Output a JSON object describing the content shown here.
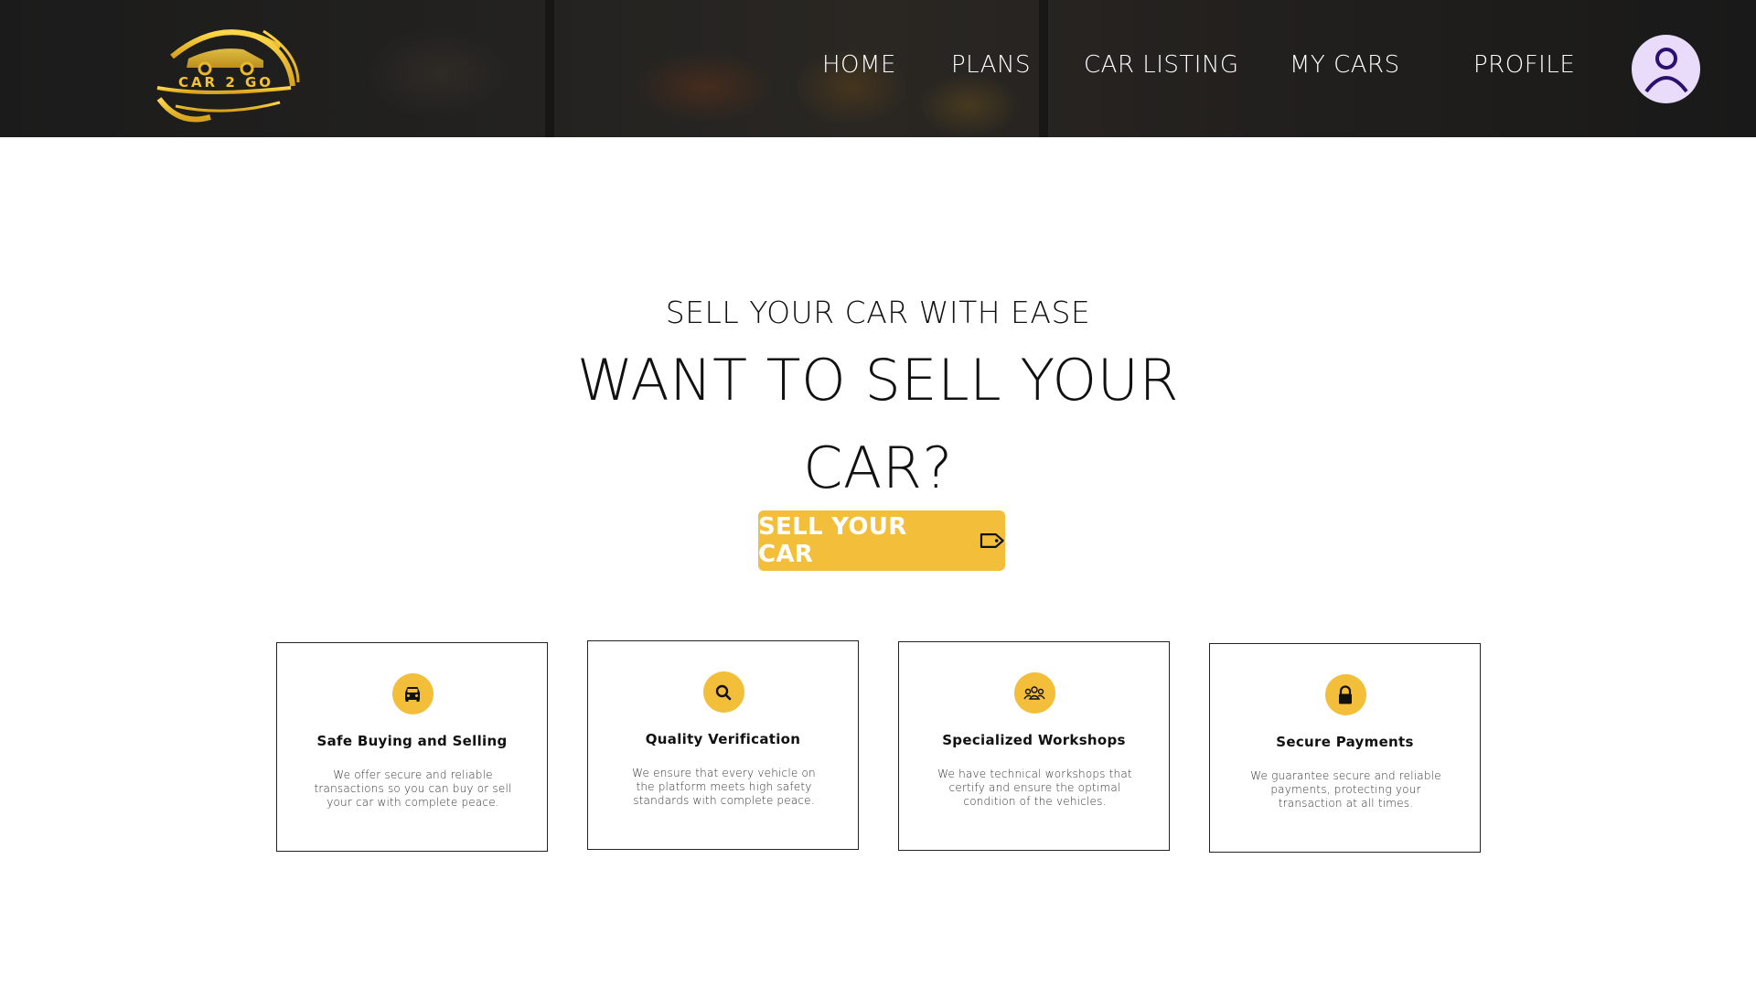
{
  "brand": {
    "logo_text": "CAR 2 GO",
    "accent": "#f3bf3a"
  },
  "nav": {
    "items": [
      "HOME",
      "PLANS",
      "CAR LISTING",
      "MY CARS",
      "PROFILE"
    ]
  },
  "avatar": {
    "icon": "user-icon",
    "bg": "#e9dcfb"
  },
  "hero": {
    "subtitle": "SELL YOUR CAR WITH EASE",
    "title_line1": "WANT TO SELL YOUR",
    "title_line2": "CAR?",
    "cta_label": "SELL YOUR CAR",
    "cta_icon": "tag-icon"
  },
  "features": [
    {
      "icon": "car-icon",
      "title": "Safe Buying and Selling",
      "text": "We offer secure and reliable transactions so you can buy or sell your car with complete peace."
    },
    {
      "icon": "search-icon",
      "title": "Quality Verification",
      "text": "We ensure that every vehicle on the platform meets high safety standards with complete peace."
    },
    {
      "icon": "group-icon",
      "title": "Specialized Workshops",
      "text": "We have technical workshops that certify and ensure the optimal condition of the vehicles."
    },
    {
      "icon": "lock-icon",
      "title": "Secure Payments",
      "text": "We guarantee secure and reliable payments, protecting your transaction at all times."
    }
  ]
}
